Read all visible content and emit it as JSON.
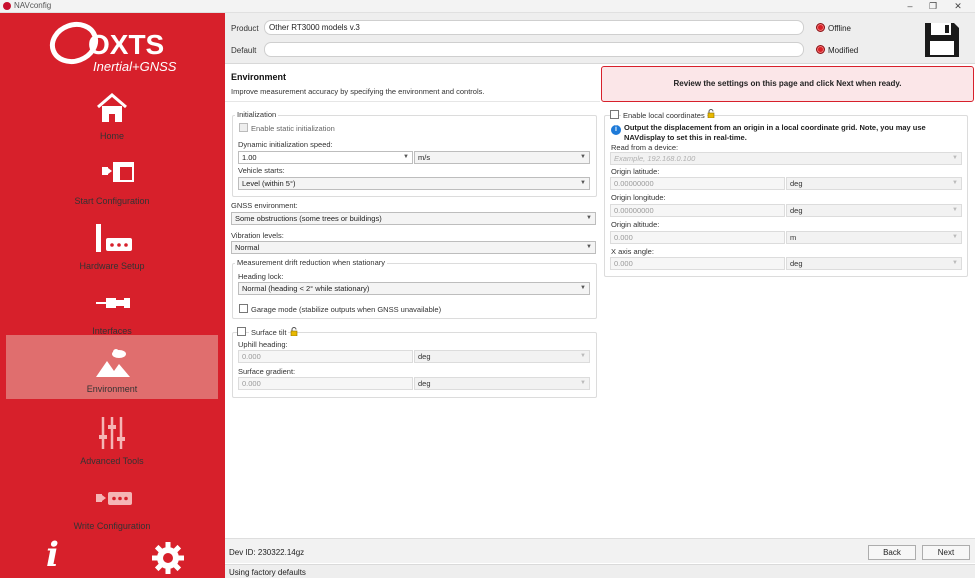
{
  "window": {
    "title": "NAVconfig",
    "minimize": "–",
    "maximize": "❐",
    "close": "✕"
  },
  "brand": {
    "logo_main": "OXTS",
    "logo_sub": "Inertial+GNSS",
    "color": "#d7202b"
  },
  "sidebar": {
    "items": [
      {
        "label": "Home",
        "icon": "home-icon"
      },
      {
        "label": "Start Configuration",
        "icon": "start-config-icon"
      },
      {
        "label": "Hardware Setup",
        "icon": "hardware-icon"
      },
      {
        "label": "Interfaces",
        "icon": "interfaces-icon"
      },
      {
        "label": "Environment",
        "icon": "environment-icon",
        "active": true
      },
      {
        "label": "Advanced Tools",
        "icon": "sliders-icon",
        "disabled": true
      },
      {
        "label": "Write Configuration",
        "icon": "write-config-icon",
        "disabled": true
      }
    ],
    "info_glyph": "i"
  },
  "header": {
    "product_label": "Product",
    "product_value": "Other RT3000 models v.3",
    "default_label": "Default",
    "default_value": "",
    "status_offline": "Offline",
    "status_modified": "Modified"
  },
  "page": {
    "title": "Environment",
    "subtitle": "Improve measurement accuracy by specifying the environment and controls.",
    "banner": "Review the settings on this page and click Next when ready."
  },
  "initialization": {
    "legend": "Initialization",
    "static_label": "Enable static initialization",
    "speed_label": "Dynamic initialization speed:",
    "speed_value": "1.00",
    "speed_unit": "m/s",
    "vehicle_label": "Vehicle starts:",
    "vehicle_value": "Level (within 5°)"
  },
  "gnss": {
    "label": "GNSS environment:",
    "value": "Some obstructions (some trees or buildings)"
  },
  "vibration": {
    "label": "Vibration levels:",
    "value": "Normal"
  },
  "drift": {
    "legend": "Measurement drift reduction when stationary",
    "heading_label": "Heading lock:",
    "heading_value": "Normal (heading < 2° while stationary)",
    "garage_label": "Garage mode (stabilize outputs when GNSS unavailable)"
  },
  "tilt": {
    "label": "Surface tilt",
    "uphill_label": "Uphill heading:",
    "uphill_value": "0.000",
    "uphill_unit": "deg",
    "gradient_label": "Surface gradient:",
    "gradient_value": "0.000",
    "gradient_unit": "deg"
  },
  "local": {
    "label": "Enable local coordinates",
    "info": "Output the displacement from an origin in a local coordinate grid. Note, you may use NAVdisplay to set this in real-time.",
    "device_label": "Read from a device:",
    "device_placeholder": "Example, 192.168.0.100",
    "lat_label": "Origin latitude:",
    "lat_value": "0.00000000",
    "lat_unit": "deg",
    "lon_label": "Origin longitude:",
    "lon_value": "0.00000000",
    "lon_unit": "deg",
    "alt_label": "Origin altitude:",
    "alt_value": "0.000",
    "alt_unit": "m",
    "xaxis_label": "X axis angle:",
    "xaxis_value": "0.000",
    "xaxis_unit": "deg"
  },
  "footer": {
    "dev_id": "Dev ID: 230322.14gz",
    "back": "Back",
    "next": "Next",
    "status": "Using factory defaults"
  }
}
